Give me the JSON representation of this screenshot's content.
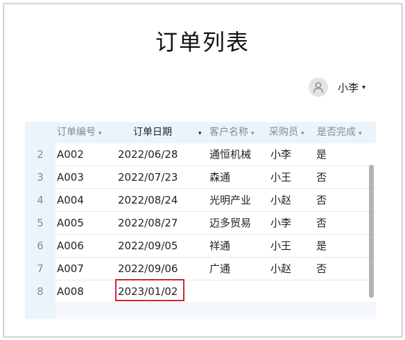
{
  "page": {
    "title": "订单列表"
  },
  "user": {
    "name": "小李",
    "caret": "▾"
  },
  "table": {
    "columns": [
      {
        "label": "订单编号",
        "caret": "▾"
      },
      {
        "label": "订单日期",
        "caret": "▾"
      },
      {
        "label": "客户名称",
        "caret": "▾"
      },
      {
        "label": "采购员",
        "caret": "▾"
      },
      {
        "label": "是否完成",
        "caret": "▾"
      }
    ],
    "rows": [
      {
        "num": "2",
        "order_id": "A002",
        "date": "2022/06/28",
        "customer": "通恒机械",
        "buyer": "小李",
        "done": "是"
      },
      {
        "num": "3",
        "order_id": "A003",
        "date": "2022/07/23",
        "customer": "森通",
        "buyer": "小王",
        "done": "否"
      },
      {
        "num": "4",
        "order_id": "A004",
        "date": "2022/08/24",
        "customer": "光明产业",
        "buyer": "小赵",
        "done": "否"
      },
      {
        "num": "5",
        "order_id": "A005",
        "date": "2022/08/27",
        "customer": "迈多贸易",
        "buyer": "小李",
        "done": "否"
      },
      {
        "num": "6",
        "order_id": "A006",
        "date": "2022/09/05",
        "customer": "祥通",
        "buyer": "小王",
        "done": "是"
      },
      {
        "num": "7",
        "order_id": "A007",
        "date": "2022/09/06",
        "customer": "广通",
        "buyer": "小赵",
        "done": "否"
      },
      {
        "num": "8",
        "order_id": "A008",
        "date": "2023/01/02",
        "customer": "",
        "buyer": "",
        "done": ""
      }
    ]
  }
}
